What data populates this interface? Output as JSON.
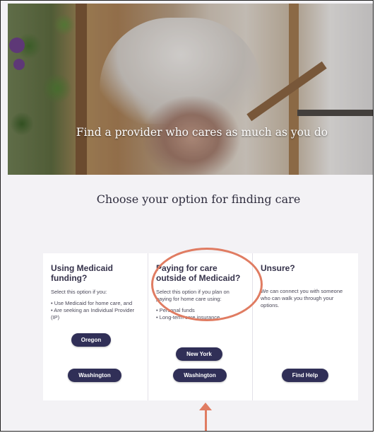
{
  "hero": {
    "title": "Find a provider who cares as much as you do"
  },
  "section": {
    "title": "Choose your option for finding care"
  },
  "cards": [
    {
      "title": "Using Medicaid funding?",
      "intro": "Select this option if you:",
      "items": [
        "• Use Medicaid for home care, and",
        "• Are seeking an Individual Provider (IP)"
      ],
      "buttons": [
        "Oregon",
        "Washington"
      ]
    },
    {
      "title": "Paying for care outside of Medicaid?",
      "intro": "Select this option if you plan on paying for home care using:",
      "items": [
        "• Personal funds",
        "• Long-term care insurance"
      ],
      "buttons": [
        "New York",
        "Washington"
      ]
    },
    {
      "title": "Unsure?",
      "intro": "We can connect you with someone who can walk you through your options.",
      "items": [],
      "buttons": [
        "Find Help"
      ]
    }
  ],
  "annotation": {
    "color": "#e07c62"
  },
  "colors": {
    "button": "#302f57",
    "background": "#f3f2f5"
  }
}
